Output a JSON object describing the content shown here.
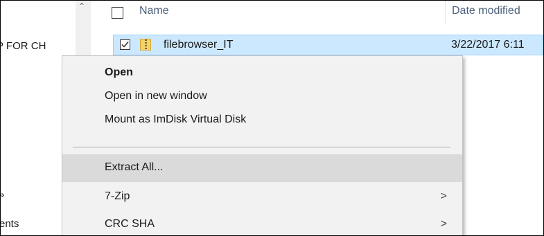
{
  "nav": {
    "items": [
      "P FOR CH",
      ":",
      "»",
      "ents"
    ]
  },
  "header": {
    "name_label": "Name",
    "date_label": "Date modified"
  },
  "file_row": {
    "name": "filebrowser_IT",
    "date": "3/22/2017 6:11"
  },
  "context_menu": {
    "items": [
      {
        "label": "Open"
      },
      {
        "label": "Open in new window"
      },
      {
        "label": "Mount as ImDisk Virtual Disk"
      },
      {
        "label": "Extract All..."
      },
      {
        "label": "7-Zip"
      },
      {
        "label": "CRC SHA"
      }
    ],
    "submenu_arrow": ">"
  },
  "colors": {
    "selection": "#cce8ff",
    "menu_bg": "#f2f2f2",
    "menu_hover": "#dadada"
  }
}
